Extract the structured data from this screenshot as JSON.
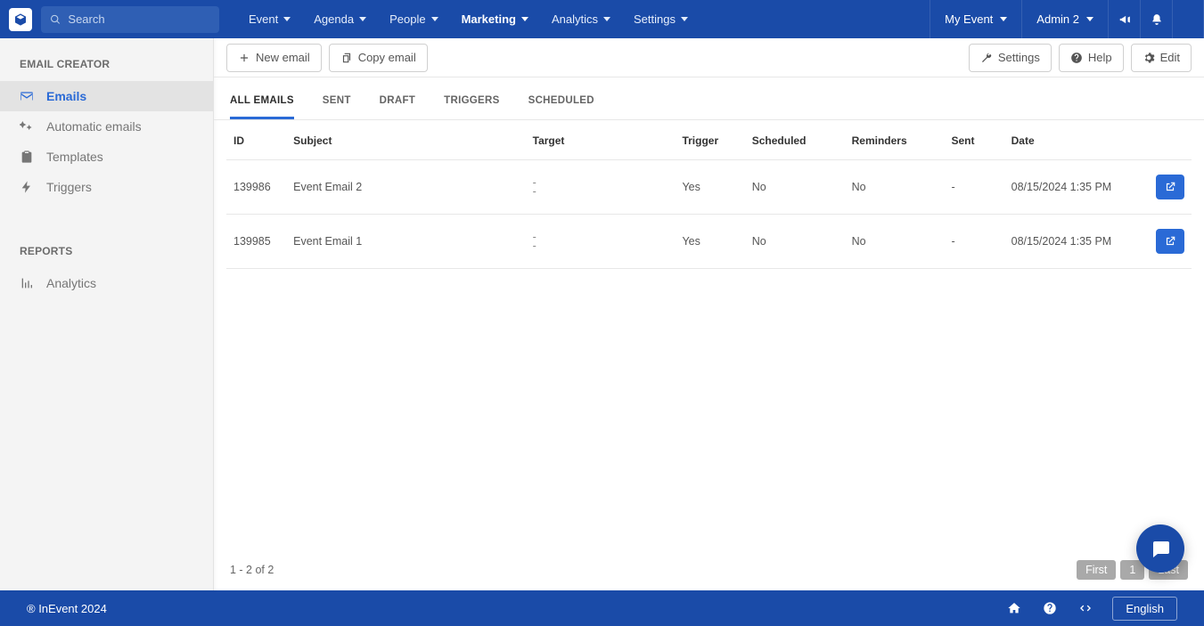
{
  "colors": {
    "brand": "#1a4ba8",
    "accent": "#2a6ad6"
  },
  "topnav": {
    "search_placeholder": "Search",
    "items": [
      {
        "label": "Event"
      },
      {
        "label": "Agenda"
      },
      {
        "label": "People"
      },
      {
        "label": "Marketing",
        "active": true
      },
      {
        "label": "Analytics"
      },
      {
        "label": "Settings"
      }
    ],
    "event_name": "My Event",
    "user_name": "Admin 2"
  },
  "sidebar": {
    "sections": [
      {
        "title": "EMAIL CREATOR",
        "items": [
          {
            "icon": "envelope-icon",
            "label": "Emails",
            "active": true
          },
          {
            "icon": "magic-icon",
            "label": "Automatic emails"
          },
          {
            "icon": "clipboard-icon",
            "label": "Templates"
          },
          {
            "icon": "bolt-icon",
            "label": "Triggers"
          }
        ]
      },
      {
        "title": "REPORTS",
        "items": [
          {
            "icon": "chart-icon",
            "label": "Analytics"
          }
        ]
      }
    ]
  },
  "toolbar": {
    "new_email": "New email",
    "copy_email": "Copy email",
    "settings": "Settings",
    "help": "Help",
    "edit": "Edit"
  },
  "tabs": [
    {
      "label": "ALL EMAILS",
      "active": true
    },
    {
      "label": "SENT"
    },
    {
      "label": "DRAFT"
    },
    {
      "label": "TRIGGERS"
    },
    {
      "label": "SCHEDULED"
    }
  ],
  "table": {
    "headers": [
      "ID",
      "Subject",
      "Target",
      "Trigger",
      "Scheduled",
      "Reminders",
      "Sent",
      "Date"
    ],
    "rows": [
      {
        "id": "139986",
        "subject": "Event Email 2",
        "target_a": "-",
        "target_b": "-",
        "trigger": "Yes",
        "scheduled": "No",
        "reminders": "No",
        "sent": "-",
        "date": "08/15/2024 1:35 PM"
      },
      {
        "id": "139985",
        "subject": "Event Email 1",
        "target_a": "-",
        "target_b": "-",
        "trigger": "Yes",
        "scheduled": "No",
        "reminders": "No",
        "sent": "-",
        "date": "08/15/2024 1:35 PM"
      }
    ]
  },
  "pager": {
    "info": "1 - 2 of 2",
    "first": "First",
    "page": "1",
    "last": "Last"
  },
  "footer": {
    "copyright": "® InEvent 2024",
    "language": "English"
  }
}
